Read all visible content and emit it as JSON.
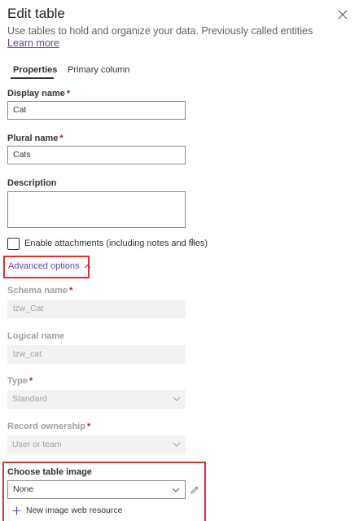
{
  "panel": {
    "title": "Edit table",
    "subtitle": "Use tables to hold and organize your data. Previously called entities",
    "learn_more": "Learn more"
  },
  "tabs": [
    {
      "label": "Properties",
      "active": true
    },
    {
      "label": "Primary column",
      "active": false
    }
  ],
  "fields": {
    "display_name": {
      "label": "Display name",
      "required": "*",
      "value": "Cat"
    },
    "plural_name": {
      "label": "Plural name",
      "required": "*",
      "value": "Cats"
    },
    "description": {
      "label": "Description",
      "value": ""
    }
  },
  "attachments": {
    "label": "Enable attachments (including notes and files)",
    "footnote": "1",
    "checked": false
  },
  "advanced_options": {
    "label": "Advanced options"
  },
  "advanced": {
    "schema_name": {
      "label": "Schema name",
      "required": "*",
      "value": "lzw_Cat"
    },
    "logical_name": {
      "label": "Logical name",
      "value": "lzw_cat"
    },
    "type": {
      "label": "Type",
      "required": "*",
      "value": "Standard"
    },
    "record_ownership": {
      "label": "Record ownership",
      "required": "*",
      "value": "User or team"
    }
  },
  "table_image": {
    "label": "Choose table image",
    "value": "None",
    "new_resource_label": "New image web resource"
  },
  "colors": {
    "accent": "#6b3fa0",
    "highlight": "#e03131",
    "required": "#a4262c"
  }
}
